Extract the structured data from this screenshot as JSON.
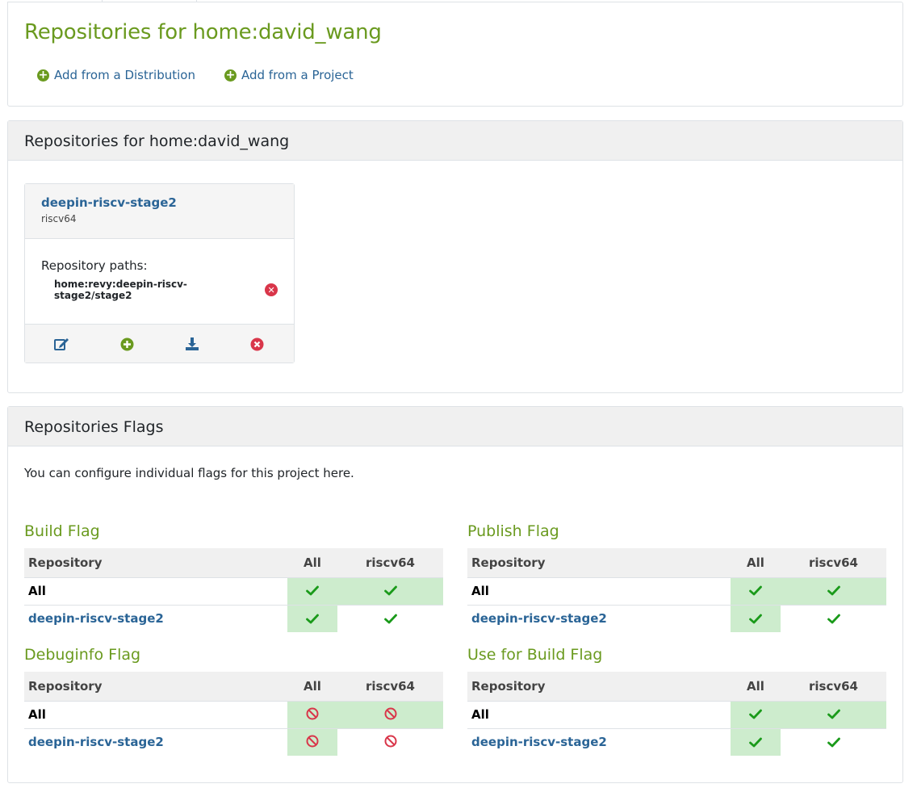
{
  "header": {
    "title": "Repositories for home:david_wang",
    "add_from_distribution": "Add from a Distribution",
    "add_from_project": "Add from a Project"
  },
  "repositories_card": {
    "title": "Repositories for home:david_wang",
    "repository": {
      "name": "deepin-riscv-stage2",
      "arch": "riscv64",
      "paths_label": "Repository paths:",
      "paths": [
        "home:revy:deepin-riscv-stage2/stage2"
      ]
    },
    "actions": [
      "edit-icon",
      "add-icon",
      "download-icon",
      "delete-icon"
    ]
  },
  "flags_card": {
    "title": "Repositories Flags",
    "description": "You can configure individual flags for this project here.",
    "columns": [
      "Repository",
      "All",
      "riscv64"
    ],
    "flags": [
      {
        "title": "Build Flag",
        "rows": [
          {
            "repo": "All",
            "all": "enabled",
            "all_highlight": true,
            "arch": "enabled",
            "arch_highlight": true
          },
          {
            "repo": "deepin-riscv-stage2",
            "all": "enabled",
            "all_highlight": true,
            "arch": "enabled",
            "arch_highlight": false
          }
        ]
      },
      {
        "title": "Publish Flag",
        "rows": [
          {
            "repo": "All",
            "all": "enabled",
            "all_highlight": true,
            "arch": "enabled",
            "arch_highlight": true
          },
          {
            "repo": "deepin-riscv-stage2",
            "all": "enabled",
            "all_highlight": true,
            "arch": "enabled",
            "arch_highlight": false
          }
        ]
      },
      {
        "title": "Debuginfo Flag",
        "rows": [
          {
            "repo": "All",
            "all": "disabled",
            "all_highlight": true,
            "arch": "disabled",
            "arch_highlight": true
          },
          {
            "repo": "deepin-riscv-stage2",
            "all": "disabled",
            "all_highlight": true,
            "arch": "disabled",
            "arch_highlight": false
          }
        ]
      },
      {
        "title": "Use for Build Flag",
        "rows": [
          {
            "repo": "All",
            "all": "enabled",
            "all_highlight": true,
            "arch": "enabled",
            "arch_highlight": true
          },
          {
            "repo": "deepin-riscv-stage2",
            "all": "enabled",
            "all_highlight": true,
            "arch": "enabled",
            "arch_highlight": false
          }
        ]
      }
    ]
  },
  "colors": {
    "title_green": "#6a9a1f",
    "link_blue": "#2a6496",
    "check_green": "#1a9a1a",
    "disabled_red": "#d9364a",
    "cell_highlight": "#cdeccd"
  }
}
